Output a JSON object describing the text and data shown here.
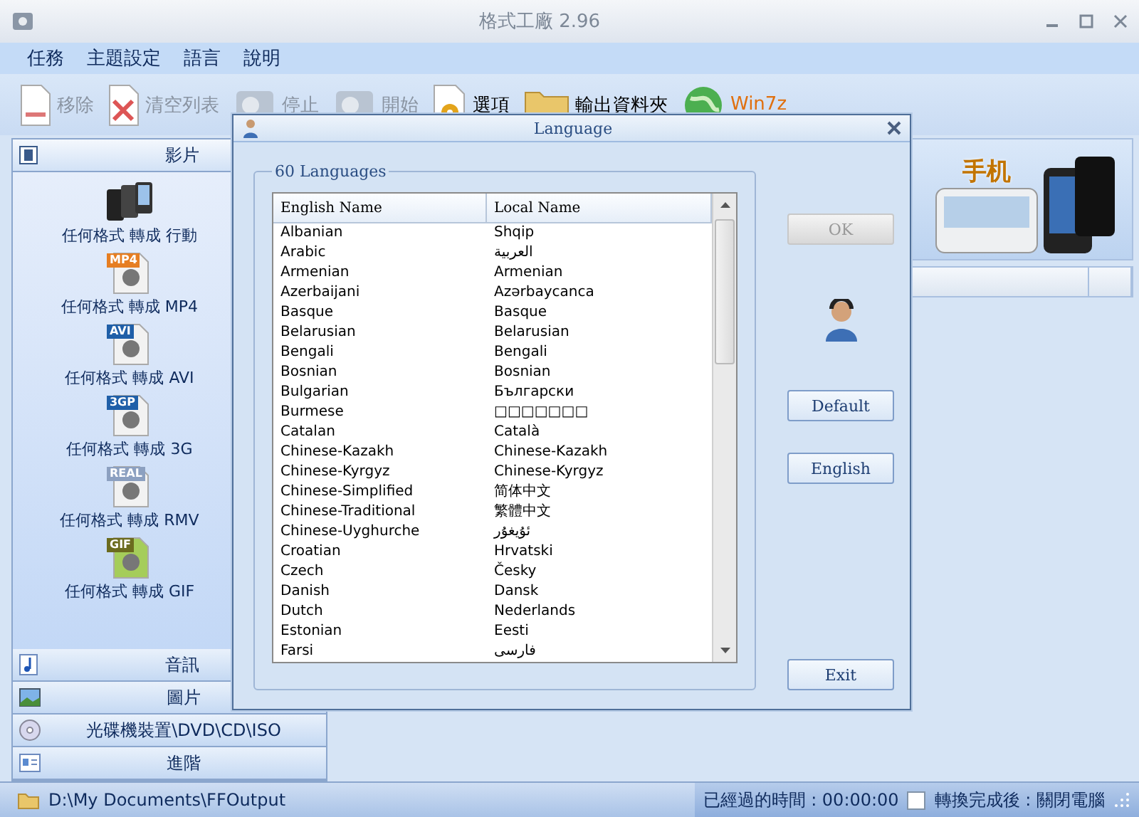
{
  "window": {
    "title": "格式工廠 2.96"
  },
  "menu": [
    "任務",
    "主題設定",
    "語言",
    "說明"
  ],
  "toolbar": [
    {
      "kind": "doc",
      "label": "移除",
      "disabled": true
    },
    {
      "kind": "clear",
      "label": "清空列表",
      "disabled": true
    },
    {
      "kind": "stop",
      "label": "停止",
      "disabled": true
    },
    {
      "kind": "start",
      "label": "開始",
      "disabled": true
    },
    {
      "kind": "options",
      "label": "選項",
      "disabled": false
    },
    {
      "kind": "folder",
      "label": "輸出資料夾",
      "disabled": false
    },
    {
      "kind": "globe",
      "label": "Win7z",
      "disabled": false
    }
  ],
  "sidebar": {
    "sections": [
      {
        "kind": "video",
        "label": "影片",
        "expanded": true,
        "items": [
          {
            "kind": "mobile",
            "label": "任何格式 轉成 行動"
          },
          {
            "kind": "mp4",
            "tag": "MP4",
            "label": "任何格式 轉成 MP4"
          },
          {
            "kind": "avi",
            "tag": "AVI",
            "label": "任何格式 轉成 AVI"
          },
          {
            "kind": "threegp",
            "tag": "3GP",
            "label": "任何格式 轉成 3G"
          },
          {
            "kind": "real",
            "tag": "REAL",
            "label": "任何格式 轉成 RMV"
          },
          {
            "kind": "gif",
            "tag": "GIF",
            "label": "任何格式 轉成 GIF"
          }
        ]
      },
      {
        "kind": "audio",
        "label": "音訊",
        "expanded": false
      },
      {
        "kind": "image",
        "label": "圖片",
        "expanded": false
      },
      {
        "kind": "disc",
        "label": "光碟機裝置\\DVD\\CD\\ISO",
        "expanded": false
      },
      {
        "kind": "advanced",
        "label": "進階",
        "expanded": false
      }
    ]
  },
  "banner": {
    "label": "手机"
  },
  "dialog": {
    "title": "Language",
    "group_label": "60 Languages",
    "columns": [
      "English Name",
      "Local Name"
    ],
    "rows": [
      [
        "Albanian",
        "Shqip"
      ],
      [
        "Arabic",
        "العربية"
      ],
      [
        "Armenian",
        "Armenian"
      ],
      [
        "Azerbaijani",
        "Azərbaycanca"
      ],
      [
        "Basque",
        "Basque"
      ],
      [
        "Belarusian",
        "Belarusian"
      ],
      [
        "Bengali",
        "Bengali"
      ],
      [
        "Bosnian",
        "Bosnian"
      ],
      [
        "Bulgarian",
        "Български"
      ],
      [
        "Burmese",
        "□□□□□□□"
      ],
      [
        "Catalan",
        "Català"
      ],
      [
        "Chinese-Kazakh",
        "Chinese-Kazakh"
      ],
      [
        "Chinese-Kyrgyz",
        "Chinese-Kyrgyz"
      ],
      [
        "Chinese-Simplified",
        "简体中文"
      ],
      [
        "Chinese-Traditional",
        "繁體中文"
      ],
      [
        "Chinese-Uyghurche",
        "ئۇيغۇر"
      ],
      [
        "Croatian",
        "Hrvatski"
      ],
      [
        "Czech",
        "Česky"
      ],
      [
        "Danish",
        "Dansk"
      ],
      [
        "Dutch",
        "Nederlands"
      ],
      [
        "Estonian",
        "Eesti"
      ],
      [
        "Farsi",
        "فارسی"
      ]
    ],
    "buttons": [
      {
        "kind": "ok",
        "label": "OK",
        "disabled": true
      },
      {
        "kind": "default",
        "label": "Default",
        "disabled": false
      },
      {
        "kind": "english",
        "label": "English",
        "disabled": false
      },
      {
        "kind": "exit",
        "label": "Exit",
        "disabled": false
      }
    ]
  },
  "status_bar": {
    "path": "D:\\My Documents\\FFOutput",
    "elapsed": "已經過的時間 : 00:00:00",
    "shutdown_checked": false,
    "shutdown_label": "轉換完成後 : 關閉電腦"
  }
}
